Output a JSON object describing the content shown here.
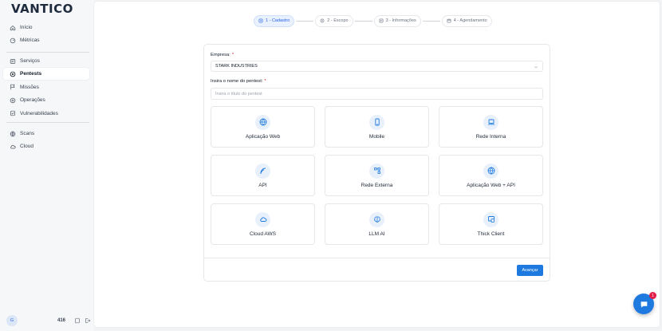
{
  "app": {
    "logo": "VANTICO"
  },
  "sidebar": {
    "group1": [
      {
        "label": "Início",
        "icon": "home-icon"
      },
      {
        "label": "Métricas",
        "icon": "metrics-icon"
      }
    ],
    "group2": [
      {
        "label": "Serviços",
        "icon": "services-icon"
      },
      {
        "label": "Pentests",
        "icon": "pentest-icon",
        "active": true
      },
      {
        "label": "Missões",
        "icon": "flag-icon"
      },
      {
        "label": "Operações",
        "icon": "operations-icon"
      },
      {
        "label": "Vulnerabilidades",
        "icon": "vulnerability-icon"
      }
    ],
    "group3": [
      {
        "label": "Scans",
        "icon": "scan-icon"
      },
      {
        "label": "Cloud",
        "icon": "cloud-icon"
      }
    ],
    "footer": {
      "avatar_initial": "G",
      "credits": "416"
    }
  },
  "stepper": [
    {
      "label": "1 - Cadastro",
      "active": true
    },
    {
      "label": "2 - Escopo",
      "active": false
    },
    {
      "label": "3 - Informações",
      "active": false
    },
    {
      "label": "4 - Agendamento",
      "active": false
    }
  ],
  "form": {
    "company_label": "Empresa:",
    "company_value": "STARK INDUSTRIES",
    "name_label": "Insira o nome do pentest:",
    "name_placeholder": "Insira o título do pentest",
    "required_mark": "*",
    "next_button": "Avançar"
  },
  "pentest_types": [
    {
      "label": "Aplicação Web",
      "icon": "globe-icon"
    },
    {
      "label": "Mobile",
      "icon": "mobile-icon"
    },
    {
      "label": "Rede Interna",
      "icon": "laptop-icon"
    },
    {
      "label": "API",
      "icon": "api-icon"
    },
    {
      "label": "Rede Externa",
      "icon": "network-icon"
    },
    {
      "label": "Aplicação Web + API",
      "icon": "globe-icon"
    },
    {
      "label": "Cloud AWS",
      "icon": "cloud-icon"
    },
    {
      "label": "LLM AI",
      "icon": "brain-icon"
    },
    {
      "label": "Thick Client",
      "icon": "desktop-app-icon"
    }
  ],
  "chat": {
    "badge": "1"
  },
  "colors": {
    "accent": "#1f7ae0",
    "active_step_bg": "#e8f1fd",
    "required": "#dc2626"
  }
}
